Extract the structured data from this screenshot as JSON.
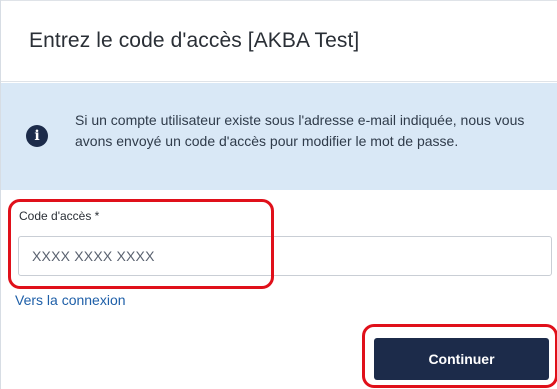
{
  "dialog": {
    "title": "Entrez le code d'accès [AKBA Test]",
    "info": {
      "icon": "info-icon",
      "icon_glyph": "i",
      "text": "Si un compte utilisateur existe sous l'adresse e-mail indiquée, nous vous avons envoyé un code d'accès pour modifier le mot de passe."
    },
    "access_code": {
      "label": "Code d'accès *",
      "value": "",
      "placeholder": "XXXX XXXX XXXX"
    },
    "login_link": "Vers la connexion",
    "continue_label": "Continuer"
  },
  "colors": {
    "primary": "#1c2b4a",
    "info_background": "#d9e8f6",
    "link": "#1e5fa8",
    "highlight": "#e0101a"
  }
}
